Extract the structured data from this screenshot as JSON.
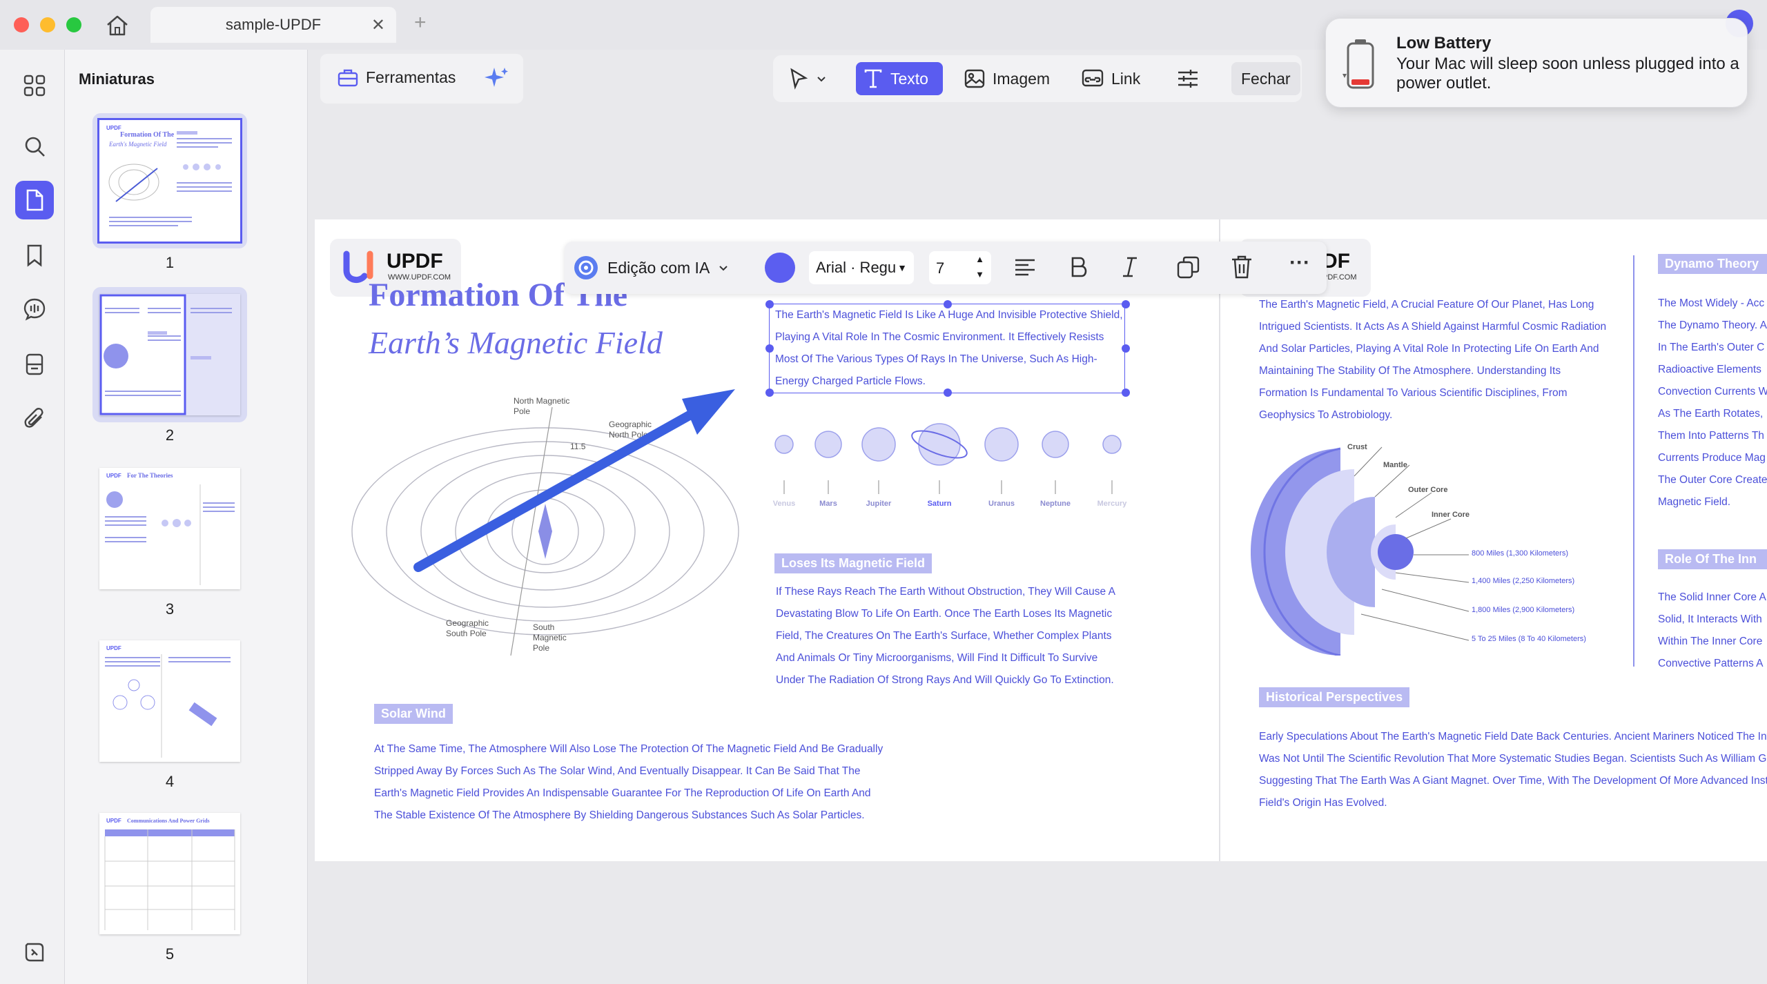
{
  "window": {
    "tab_title": "sample-UPDF",
    "close_tab": "✕",
    "new_tab": "+"
  },
  "sidebar": {
    "title": "Miniaturas",
    "pages": [
      "1",
      "2",
      "3",
      "4",
      "5"
    ]
  },
  "toolbar": {
    "tools_label": "Ferramentas",
    "text_label": "Texto",
    "image_label": "Imagem",
    "link_label": "Link",
    "close_label": "Fechar"
  },
  "format_bar": {
    "ai_edit_label": "Edição com IA",
    "font_value": "Arial · Regu",
    "font_size": "7",
    "text_color": "#5b5ef0"
  },
  "notification": {
    "title": "Low Battery",
    "body": "Your Mac will sleep soon unless plugged into a power outlet."
  },
  "page_left": {
    "logo_text": "UPDF",
    "logo_sub": "WWW.UPDF.COM",
    "title_line1": "Formation Of The",
    "title_line2": "Earth’s Magnetic Field",
    "selected_paragraph": "The Earth's Magnetic Field Is Like A Huge And Invisible Protective Shield, Playing A Vital Role In The Cosmic Environment. It Effectively Resists Most Of The Various Types Of Rays In The Universe, Such As High-Energy Charged Particle Flows.",
    "diagram_labels": {
      "north_magnetic": "North Magnetic Pole",
      "geo_north": "Geographic North Pole",
      "geo_south": "Geographic South Pole",
      "south_magnetic": "South Magnetic Pole",
      "angle": "11.5"
    },
    "planets": [
      "Venus",
      "Mars",
      "Jupiter",
      "Saturn",
      "Uranus",
      "Neptune",
      "Mercury"
    ],
    "section2_tag": "Loses Its Magnetic Field",
    "section2_text": "If These Rays Reach The Earth Without Obstruction, They Will Cause A Devastating Blow To Life On Earth. Once The Earth Loses Its Magnetic Field, The Creatures On The Earth's Surface, Whether Complex Plants And Animals Or Tiny Microorganisms, Will Find It Difficult To Survive Under The Radiation Of Strong Rays And Will Quickly Go To Extinction.",
    "section3_tag": "Solar Wind",
    "section3_text": "At The Same Time, The Atmosphere Will Also Lose The Protection Of The Magnetic Field And Be Gradually Stripped Away By Forces Such As The Solar Wind, And Eventually Disappear. It Can Be Said That The Earth's Magnetic Field Provides An Indispensable Guarantee For The Reproduction Of Life On Earth And The Stable Existence Of The Atmosphere By Shielding Dangerous Substances Such As Solar Particles."
  },
  "page_right": {
    "logo_text": "DF",
    "logo_sub": "PDF.COM",
    "intro": "The Earth's Magnetic Field, A Crucial Feature Of Our Planet, Has Long Intrigued Scientists. It Acts As A Shield Against Harmful Cosmic Radiation And Solar Particles, Playing A Vital Role In Protecting Life On Earth And Maintaining The Stability Of The Atmosphere. Understanding Its Formation Is Fundamental To Various Scientific Disciplines, From Geophysics To Astrobiology.",
    "layers": [
      "Crust",
      "Mantle",
      "Outer Core",
      "Inner Core"
    ],
    "depths": [
      "800 Miles (1,300 Kilometers)",
      "1,400 Miles (2,250 Kilometers)",
      "1,800 Miles (2,900 Kilometers)",
      "5 To 25 Miles (8 To 40 Kilometers)"
    ],
    "dynamo_tag": "Dynamo Theory",
    "dynamo_lines": [
      "The Most Widely - Acc",
      "The Dynamo Theory. A",
      "In The Earth's Outer C",
      "Radioactive Elements",
      "Convection Currents W",
      "As The Earth Rotates,",
      "Them Into Patterns Th",
      "Currents Produce Mag",
      "The Outer Core Create",
      "Magnetic Field."
    ],
    "role_tag": "Role Of The Inn",
    "role_lines": [
      "The Solid Inner Core A",
      "Solid, It Interacts With",
      "Within The Inner Core",
      "Convective Patterns A"
    ],
    "hist_tag": "Historical Perspectives",
    "hist_lines": [
      "Early Speculations About The Earth's Magnetic Field Date Back Centuries. Ancient Mariners Noticed The Influe",
      "Was Not Until The Scientific Revolution That More Systematic Studies Began. Scientists Such As William Gilbe",
      "Suggesting That The Earth Was A Giant Magnet. Over Time, With The Development Of More Advanced Instru",
      "Field's Origin Has Evolved."
    ]
  }
}
